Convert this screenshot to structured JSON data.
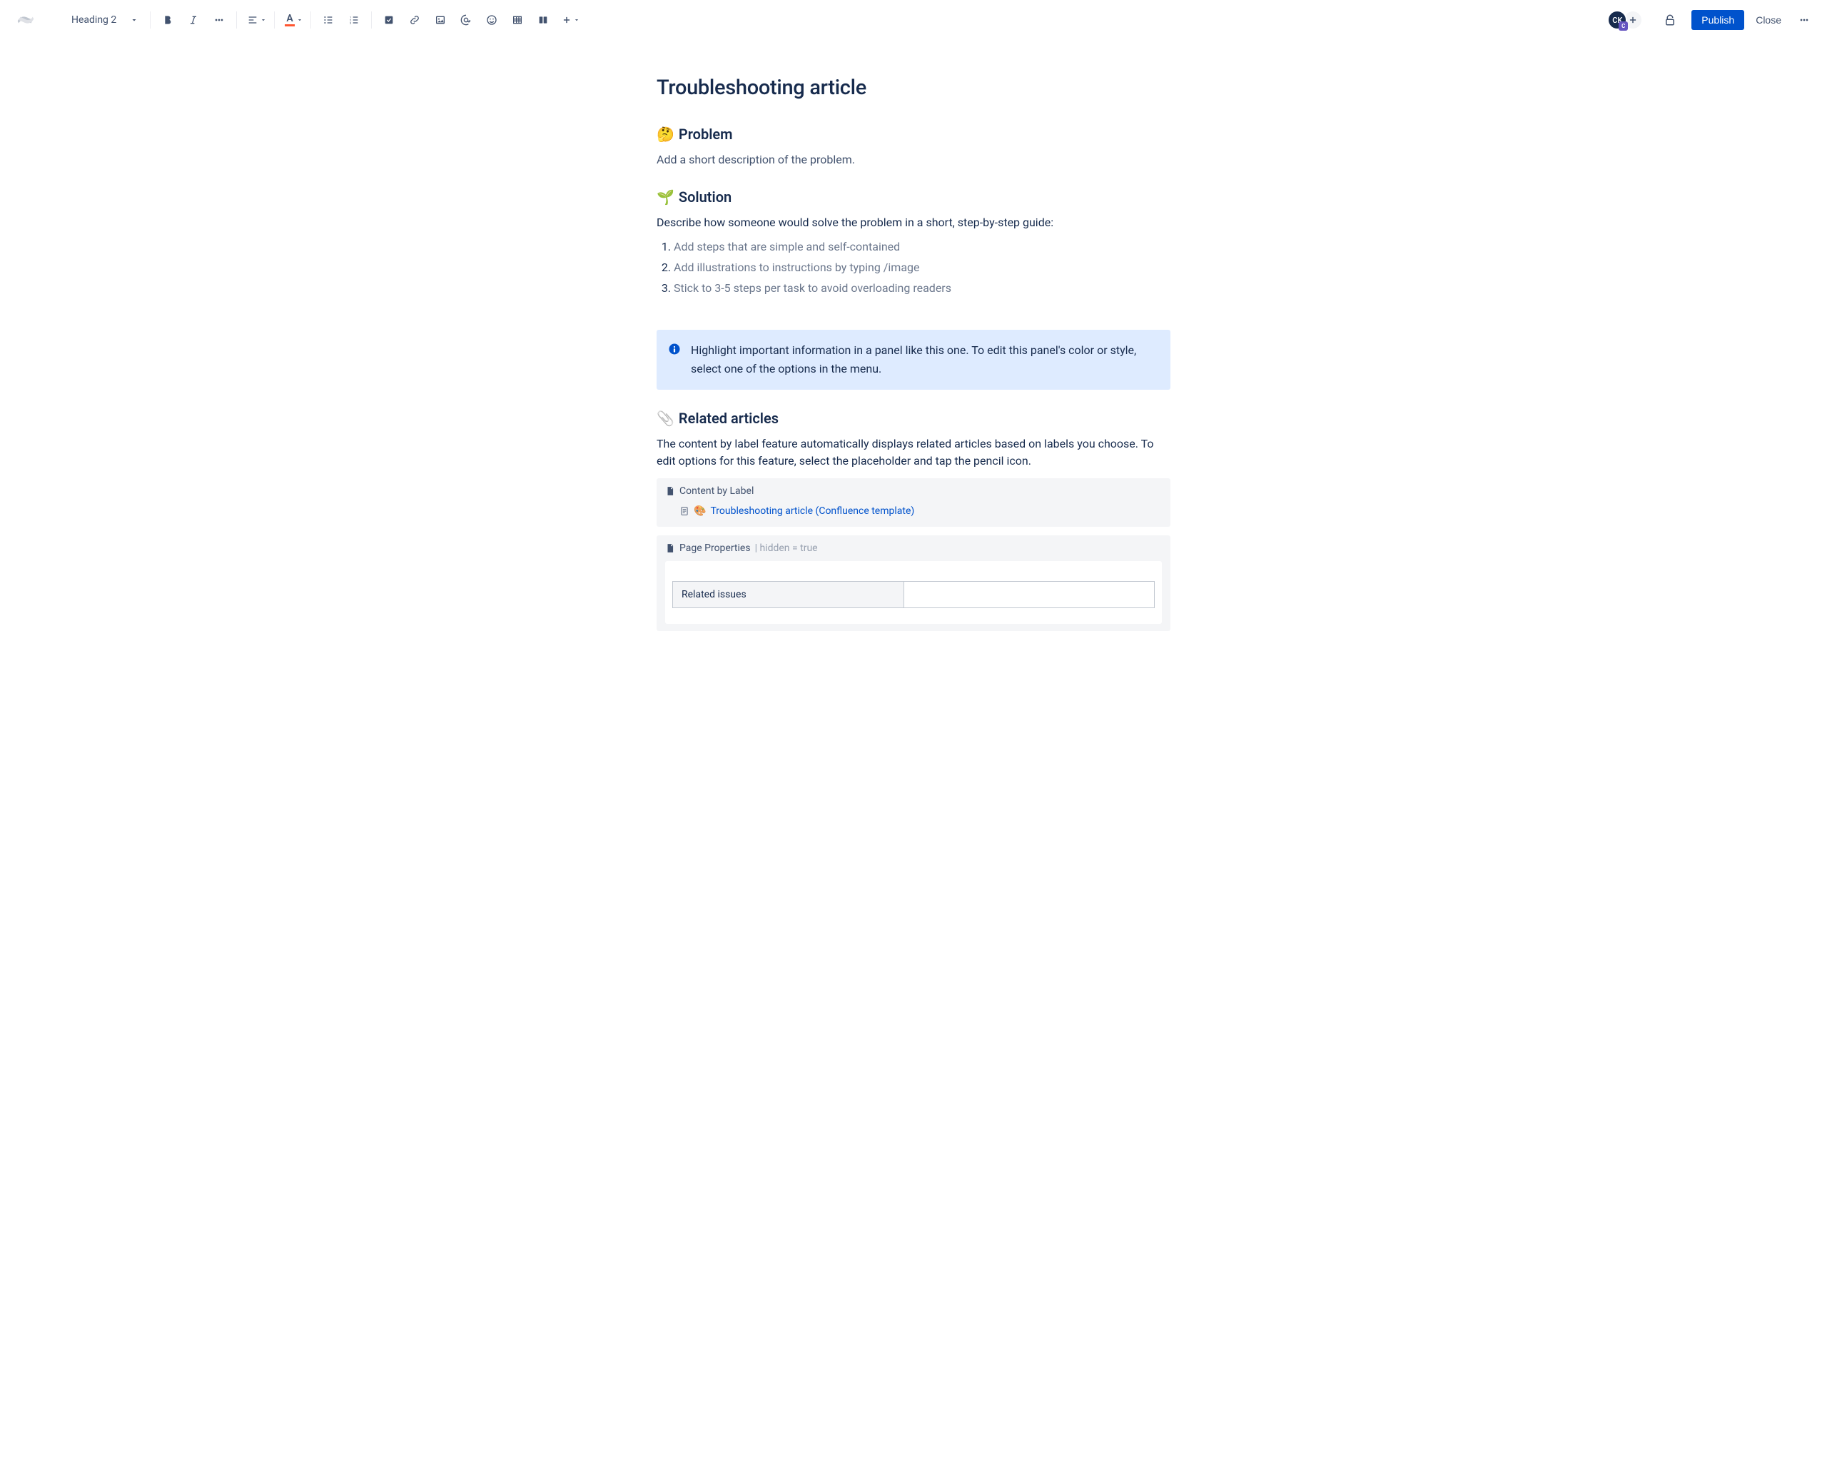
{
  "toolbar": {
    "text_style": "Heading 2",
    "text_color_underline": "#FF5630"
  },
  "header": {
    "avatar_initials": "CK",
    "avatar_badge": "C",
    "publish_label": "Publish",
    "close_label": "Close"
  },
  "page": {
    "title": "Troubleshooting article",
    "sections": {
      "problem": {
        "emoji": "🤔",
        "heading": "Problem",
        "body": "Add a short description of the problem."
      },
      "solution": {
        "emoji": "🌱",
        "heading": "Solution",
        "intro": "Describe how someone would solve the problem in a short, step-by-step guide:",
        "steps": [
          "Add steps that are simple and self-contained",
          "Add illustrations to instructions by typing /image",
          "Stick to 3-5 steps per task to avoid overloading readers"
        ]
      },
      "info_panel": {
        "text": "Highlight important information in a panel like this one. To edit this panel's color or style, select one of the options in the menu."
      },
      "related": {
        "emoji": "📎",
        "heading": "Related articles",
        "body": "The content by label feature automatically displays related articles based on labels you choose. To edit options for this feature, select the placeholder and tap the pencil icon."
      }
    },
    "macros": {
      "content_by_label": {
        "title": "Content by Label",
        "item_emoji": "🎨",
        "item_text": "Troubleshooting article (Confluence template)"
      },
      "page_properties": {
        "title": "Page Properties",
        "meta": "| hidden = true",
        "row_label": "Related issues",
        "row_value": ""
      }
    }
  }
}
